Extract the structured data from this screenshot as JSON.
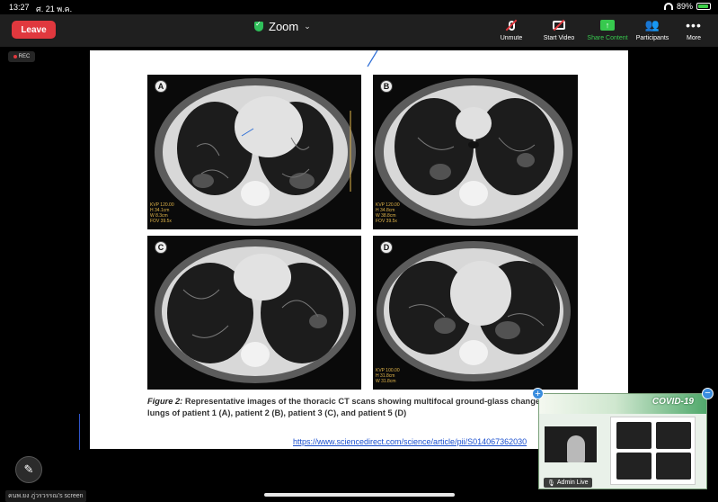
{
  "status_bar": {
    "time": "13:27",
    "date": "ศ. 21 พ.ค.",
    "battery": "89%",
    "battery_level": 0.89
  },
  "toolbar": {
    "leave_label": "Leave",
    "title": "Zoom",
    "items": [
      {
        "label": "Unmute",
        "icon": "microphone-muted-icon"
      },
      {
        "label": "Start Video",
        "icon": "video-off-icon"
      },
      {
        "label": "Share Content",
        "icon": "share-screen-icon"
      },
      {
        "label": "Participants",
        "icon": "participants-icon"
      },
      {
        "label": "More",
        "icon": "more-dots-icon"
      }
    ]
  },
  "recording": {
    "label": "REC"
  },
  "slide": {
    "panels": [
      "A",
      "B",
      "C",
      "D"
    ],
    "caption_fig": "Figure 2:",
    "caption_text": "Representative images of the thoracic CT scans showing multifocal ground-glass change",
    "caption_line2": "lungs of patient 1 (A), patient 2 (B), patient 3 (C), and patient 5 (D)",
    "url": "https://www.sciencedirect.com/science/article/pii/S014067362030",
    "scan_meta": [
      [
        "KVP 120.00",
        "H 34.1cm",
        "W 8.3cm",
        "FOV 39.5x"
      ],
      [
        "KVP 120.00",
        "H 34.8cm",
        "W 38.8cm",
        "FOV 39.5x"
      ],
      [
        "",
        "",
        "",
        ""
      ],
      [
        "KVP 100.00",
        "H 31.8cm",
        "W 31.8cm",
        ""
      ]
    ]
  },
  "thumbnail": {
    "title": "COVID-19",
    "participant_label": "Admin Live"
  },
  "screen_share_label": "คนพ.ยง ภู่วรวรรณ's screen",
  "colors": {
    "leave": "#e0383e",
    "toolbar_bg": "#1f1f1f",
    "share_green": "#37c94e"
  }
}
